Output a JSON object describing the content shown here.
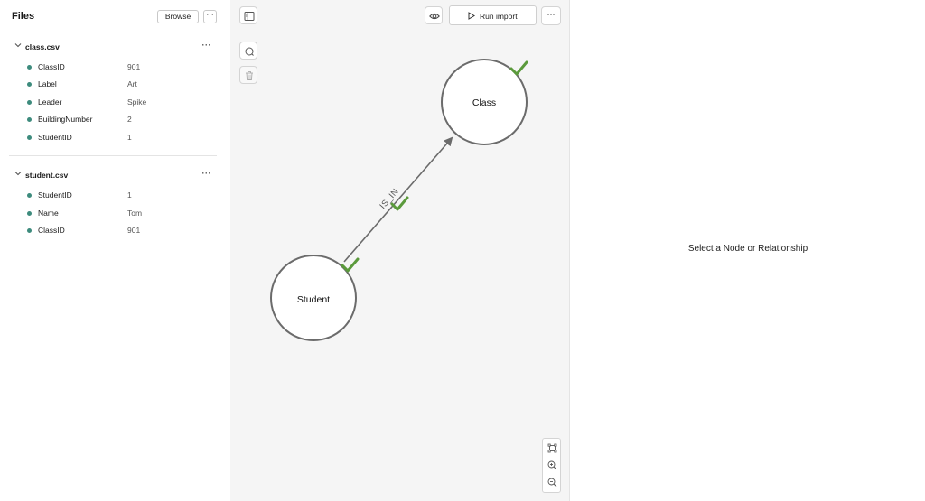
{
  "files_panel": {
    "title": "Files",
    "browse_label": "Browse",
    "more_label": "···",
    "files": [
      {
        "name": "class.csv",
        "more_label": "···",
        "columns": [
          {
            "name": "ClassID",
            "value": "901"
          },
          {
            "name": "Label",
            "value": "Art"
          },
          {
            "name": "Leader",
            "value": "Spike"
          },
          {
            "name": "BuildingNumber",
            "value": "2"
          },
          {
            "name": "StudentID",
            "value": "1"
          }
        ]
      },
      {
        "name": "student.csv",
        "more_label": "···",
        "columns": [
          {
            "name": "StudentID",
            "value": "1"
          },
          {
            "name": "Name",
            "value": "Tom"
          },
          {
            "name": "ClassID",
            "value": "901"
          }
        ]
      }
    ]
  },
  "toolbar": {
    "run_import_label": "Run import",
    "more_label": "···"
  },
  "graph": {
    "nodes": [
      {
        "label": "Class",
        "mapped": true
      },
      {
        "label": "Student",
        "mapped": true
      }
    ],
    "relationships": [
      {
        "label": "IS_IN",
        "from": "Student",
        "to": "Class",
        "mapped": true
      }
    ],
    "check_color": "#5b9a3c",
    "node_border_color": "#6b6b6b"
  },
  "details": {
    "empty_message": "Select a Node or Relationship"
  },
  "colors": {
    "accent_dot": "#3d8b7d",
    "canvas_bg": "#f5f5f5"
  }
}
